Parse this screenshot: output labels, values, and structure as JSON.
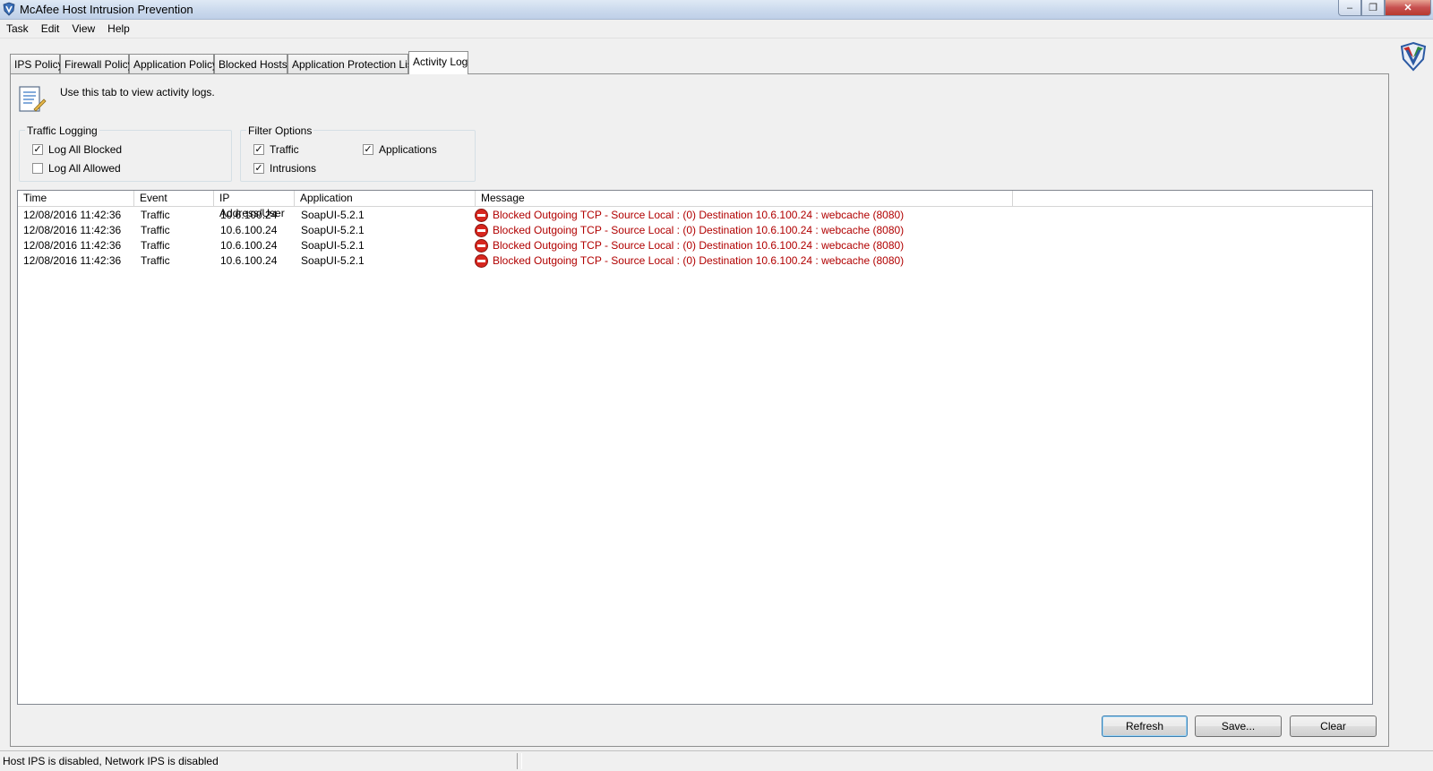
{
  "window": {
    "title": "McAfee Host Intrusion Prevention",
    "close_label": "✕",
    "min_label": "‒",
    "max_label": "❐"
  },
  "menu": [
    "Task",
    "Edit",
    "View",
    "Help"
  ],
  "tabs": [
    "IPS Policy",
    "Firewall Policy",
    "Application Policy",
    "Blocked Hosts",
    "Application Protection List",
    "Activity Log"
  ],
  "active_tab": "Activity Log",
  "info_text": "Use this tab to view activity logs.",
  "traffic_logging": {
    "title": "Traffic Logging",
    "options": [
      {
        "label": "Log All Blocked",
        "checked": true
      },
      {
        "label": "Log All Allowed",
        "checked": false
      }
    ]
  },
  "filter_options": {
    "title": "Filter Options",
    "options": [
      {
        "label": "Traffic",
        "checked": true
      },
      {
        "label": "Intrusions",
        "checked": true
      },
      {
        "label": "Applications",
        "checked": true
      }
    ]
  },
  "table": {
    "columns": [
      "Time",
      "Event",
      "IP Address/User",
      "Application",
      "Message"
    ],
    "rows": [
      {
        "time": "12/08/2016 11:42:36",
        "event": "Traffic",
        "ip": "10.6.100.24",
        "app": "SoapUI-5.2.1",
        "message": "Blocked Outgoing TCP -  Source Local :  (0)  Destination 10.6.100.24 : webcache (8080)"
      },
      {
        "time": "12/08/2016 11:42:36",
        "event": "Traffic",
        "ip": "10.6.100.24",
        "app": "SoapUI-5.2.1",
        "message": "Blocked Outgoing TCP -  Source Local :  (0)  Destination 10.6.100.24 : webcache (8080)"
      },
      {
        "time": "12/08/2016 11:42:36",
        "event": "Traffic",
        "ip": "10.6.100.24",
        "app": "SoapUI-5.2.1",
        "message": "Blocked Outgoing TCP -  Source Local :  (0)  Destination 10.6.100.24 : webcache (8080)"
      },
      {
        "time": "12/08/2016 11:42:36",
        "event": "Traffic",
        "ip": "10.6.100.24",
        "app": "SoapUI-5.2.1",
        "message": "Blocked Outgoing TCP -  Source Local :  (0)  Destination 10.6.100.24 : webcache (8080)"
      }
    ]
  },
  "buttons": {
    "refresh": "Refresh",
    "save": "Save...",
    "clear": "Clear"
  },
  "status": {
    "left": "Host IPS is disabled, Network IPS is disabled",
    "right": ""
  },
  "colors": {
    "message_text": "#b10000",
    "block_icon": "#d7261e"
  },
  "icons": {
    "app": "mcafee-shield-icon",
    "info": "log-document-icon",
    "row": "blocked-icon"
  }
}
